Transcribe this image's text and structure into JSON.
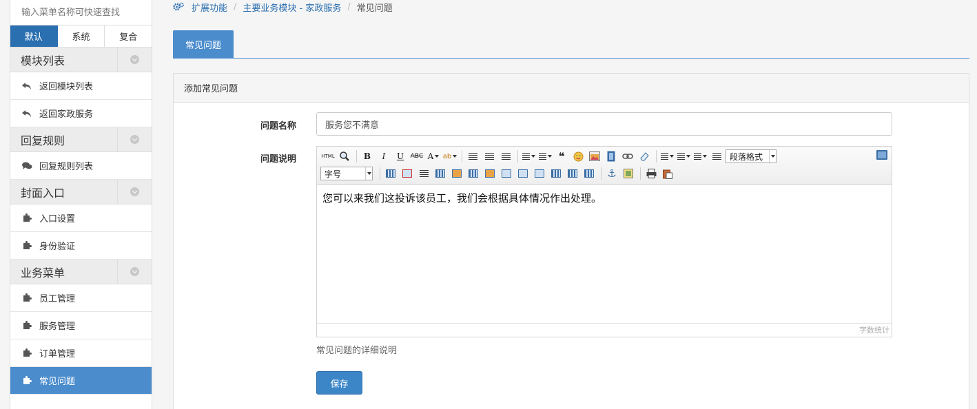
{
  "sidebar": {
    "search_placeholder": "输入菜单名称可快速查找",
    "tabs": [
      "默认",
      "系统",
      "复合"
    ],
    "groups": [
      {
        "title": "模块列表",
        "items": [
          "返回模块列表",
          "返回家政服务"
        ]
      },
      {
        "title": "回复规则",
        "items": [
          "回复规则列表"
        ]
      },
      {
        "title": "封面入口",
        "items": [
          "入口设置",
          "身份验证"
        ]
      },
      {
        "title": "业务菜单",
        "items": [
          "员工管理",
          "服务管理",
          "订单管理",
          "常见问题"
        ]
      }
    ]
  },
  "breadcrumb": {
    "home": "扩展功能",
    "module": "主要业务模块 - 家政服务",
    "current": "常见问题"
  },
  "page_tab": "常见问题",
  "panel": {
    "title": "添加常见问题",
    "name_label": "问题名称",
    "name_value": "服务您不满意",
    "desc_label": "问题说明",
    "editor_content": "您可以来我们这投诉该员工，我们会根据具体情况作出处理。",
    "word_count": "字数统计",
    "help_text": "常见问题的详细说明",
    "save_label": "保存"
  },
  "toolbar": {
    "html_label": "HTML",
    "paragraph_label": "段落格式",
    "fontsize_label": "字号"
  },
  "colors": {
    "primary": "#4b8ccd",
    "primary_dark": "#2a6fb0",
    "save_button": "#3c86c8"
  }
}
